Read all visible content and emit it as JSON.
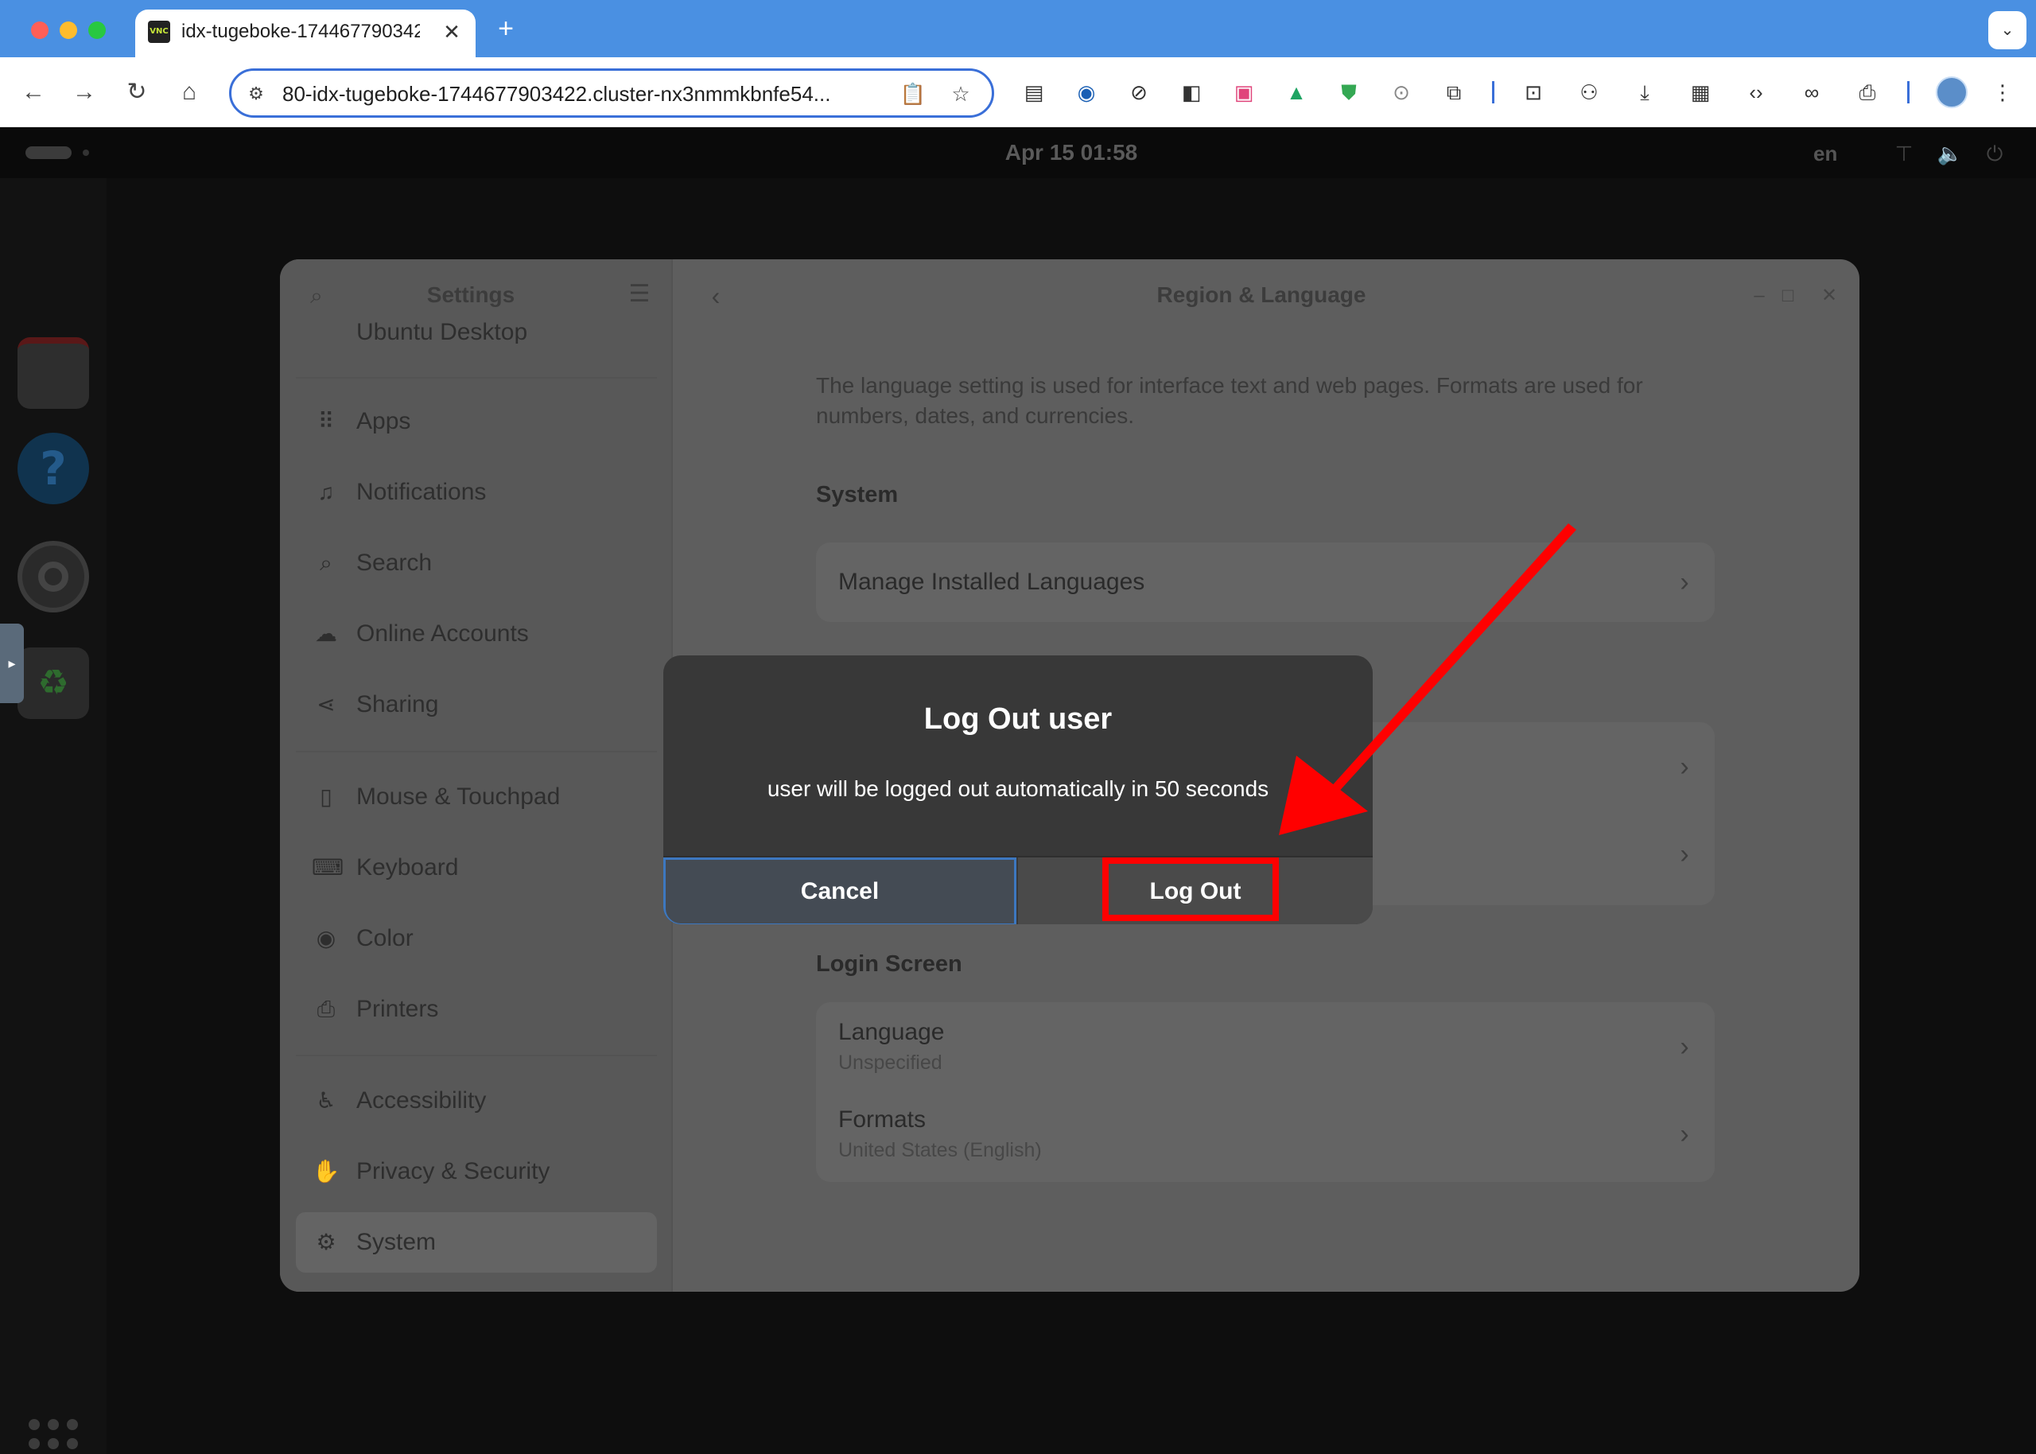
{
  "browser": {
    "tab_title": "idx-tugeboke-1744677903422",
    "tab_favicon_text": "VNC",
    "tab_close": "✕",
    "new_tab": "+",
    "tab_menu": "⌄",
    "url": "80-idx-tugeboke-1744677903422.cluster-nx3nmmkbnfe54..."
  },
  "desktop": {
    "clock": "Apr 15  01:58",
    "language_indicator": "en"
  },
  "settings": {
    "sidebar_title": "Settings",
    "sidebar_cut_item": "Ubuntu Desktop",
    "sidebar_items": [
      {
        "label": "Apps",
        "icon": "apps-grid-icon"
      },
      {
        "label": "Notifications",
        "icon": "bell-icon"
      },
      {
        "label": "Search",
        "icon": "search-icon"
      },
      {
        "label": "Online Accounts",
        "icon": "cloud-icon"
      },
      {
        "label": "Sharing",
        "icon": "share-icon"
      },
      {
        "label": "Mouse & Touchpad",
        "icon": "mouse-icon"
      },
      {
        "label": "Keyboard",
        "icon": "keyboard-icon"
      },
      {
        "label": "Color",
        "icon": "color-icon"
      },
      {
        "label": "Printers",
        "icon": "printer-icon"
      },
      {
        "label": "Accessibility",
        "icon": "accessibility-icon"
      },
      {
        "label": "Privacy & Security",
        "icon": "hand-icon"
      },
      {
        "label": "System",
        "icon": "gear-icon"
      }
    ],
    "active_item": "System",
    "page_title": "Region & Language",
    "description": "The language setting is used for interface text and web pages. Formats are used for numbers, dates, and currencies.",
    "system_section": "System",
    "manage_languages": "Manage Installed Languages",
    "login_screen_section": "Login Screen",
    "login_language_label": "Language",
    "login_language_value": "Unspecified",
    "login_formats_label": "Formats",
    "login_formats_value": "United States (English)"
  },
  "dialog": {
    "title": "Log Out user",
    "message": "user will be logged out automatically in 50 seconds",
    "cancel_label": "Cancel",
    "logout_label": "Log Out"
  },
  "colors": {
    "annotation": "#ff0000",
    "tabstrip": "#4a90e2",
    "focus_ring": "#3d78c0"
  }
}
